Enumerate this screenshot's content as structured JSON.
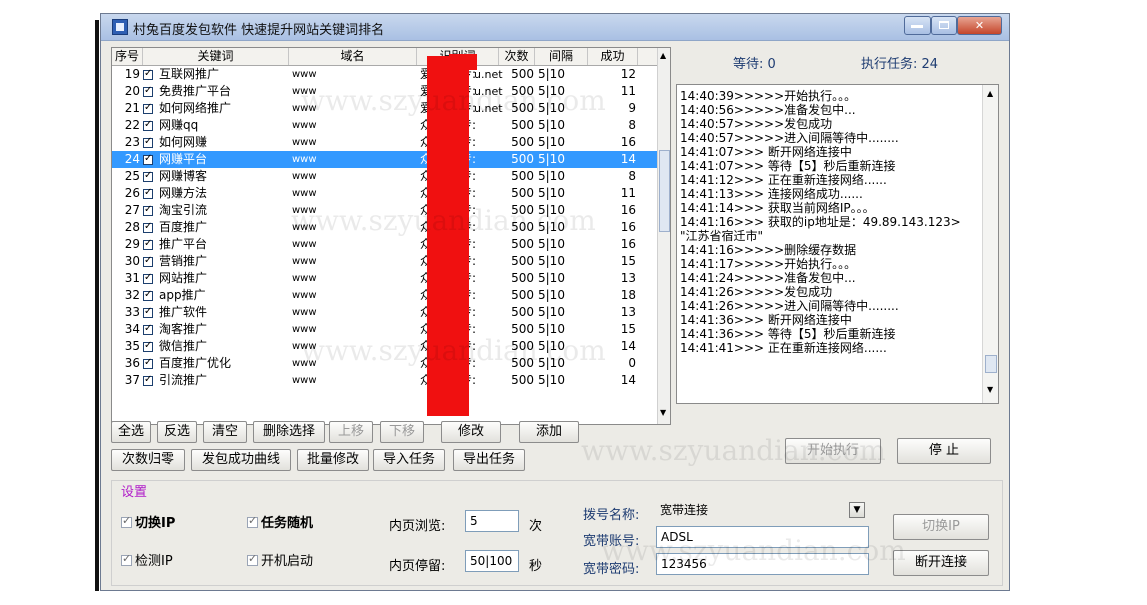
{
  "window": {
    "title": "村兔百度发包软件 快速提升网站关键词排名"
  },
  "table": {
    "headers": [
      "序号",
      "关键词",
      "域名",
      "识别词",
      "次数",
      "间隔",
      "成功"
    ],
    "rows": [
      {
        "no": "19",
        "kw": "互联网推广",
        "domain": "www",
        "domain_tail": "u.net",
        "src": "爱合购|专:",
        "count": "500",
        "interval": "5|10",
        "success": "12"
      },
      {
        "no": "20",
        "kw": "免费推广平台",
        "domain": "www",
        "domain_tail": "u.net",
        "src": "爱合购|专:",
        "count": "500",
        "interval": "5|10",
        "success": "11"
      },
      {
        "no": "21",
        "kw": "如何网络推广",
        "domain": "www",
        "domain_tail": "u.net",
        "src": "爱合购|专:",
        "count": "500",
        "interval": "5|10",
        "success": "9"
      },
      {
        "no": "22",
        "kw": "网赚qq",
        "domain": "www",
        "domain_tail": "",
        "src": "众筹网|专:",
        "count": "500",
        "interval": "5|10",
        "success": "8"
      },
      {
        "no": "23",
        "kw": "如何网赚",
        "domain": "www",
        "domain_tail": "",
        "src": "众筹网|专:",
        "count": "500",
        "interval": "5|10",
        "success": "16"
      },
      {
        "no": "24",
        "kw": "网赚平台",
        "domain": "www",
        "domain_tail": "",
        "src": "众筹网|专:",
        "count": "500",
        "interval": "5|10",
        "success": "14",
        "selected": true
      },
      {
        "no": "25",
        "kw": "网赚博客",
        "domain": "www",
        "domain_tail": "",
        "src": "众筹网|专:",
        "count": "500",
        "interval": "5|10",
        "success": "8"
      },
      {
        "no": "26",
        "kw": "网赚方法",
        "domain": "www",
        "domain_tail": "",
        "src": "众筹网|专:",
        "count": "500",
        "interval": "5|10",
        "success": "11"
      },
      {
        "no": "27",
        "kw": "淘宝引流",
        "domain": "www",
        "domain_tail": "",
        "src": "众筹网|专:",
        "count": "500",
        "interval": "5|10",
        "success": "16"
      },
      {
        "no": "28",
        "kw": "百度推广",
        "domain": "www",
        "domain_tail": "",
        "src": "众筹网|专:",
        "count": "500",
        "interval": "5|10",
        "success": "16"
      },
      {
        "no": "29",
        "kw": "推广平台",
        "domain": "www",
        "domain_tail": "",
        "src": "众筹网|专:",
        "count": "500",
        "interval": "5|10",
        "success": "16"
      },
      {
        "no": "30",
        "kw": "营销推广",
        "domain": "www",
        "domain_tail": "",
        "src": "众筹网|专:",
        "count": "500",
        "interval": "5|10",
        "success": "15"
      },
      {
        "no": "31",
        "kw": "网站推广",
        "domain": "www",
        "domain_tail": "",
        "src": "众筹网|专:",
        "count": "500",
        "interval": "5|10",
        "success": "13"
      },
      {
        "no": "32",
        "kw": "app推广",
        "domain": "www",
        "domain_tail": "",
        "src": "众筹网|专:",
        "count": "500",
        "interval": "5|10",
        "success": "18"
      },
      {
        "no": "33",
        "kw": "推广软件",
        "domain": "www",
        "domain_tail": "",
        "src": "众筹网|专:",
        "count": "500",
        "interval": "5|10",
        "success": "13"
      },
      {
        "no": "34",
        "kw": "淘客推广",
        "domain": "www",
        "domain_tail": "",
        "src": "众筹网|专:",
        "count": "500",
        "interval": "5|10",
        "success": "15"
      },
      {
        "no": "35",
        "kw": "微信推广",
        "domain": "www",
        "domain_tail": "",
        "src": "众筹网|专:",
        "count": "500",
        "interval": "5|10",
        "success": "14"
      },
      {
        "no": "36",
        "kw": "百度推广优化",
        "domain": "www",
        "domain_tail": "",
        "src": "众筹网|专:",
        "count": "500",
        "interval": "5|10",
        "success": "0"
      },
      {
        "no": "37",
        "kw": "引流推广",
        "domain": "www",
        "domain_tail": "",
        "src": "众筹网|专:",
        "count": "500",
        "interval": "5|10",
        "success": "14"
      }
    ]
  },
  "status": {
    "wait": "等待: 0",
    "tasks": "执行任务: 24"
  },
  "log": [
    "14:40:39>>>>>开始执行。。。",
    "14:40:56>>>>>准备发包中...",
    "14:40:57>>>>>发包成功",
    "14:40:57>>>>>进入间隔等待中........",
    "14:41:07>>> 断开网络连接中",
    "14:41:07>>> 等待【5】秒后重新连接",
    "14:41:12>>> 正在重新连接网络......",
    "14:41:13>>> 连接网络成功......",
    "14:41:14>>> 获取当前网络IP。。。",
    "14:41:16>>> 获取的ip地址是：49.89.143.123> \"江苏省宿迁市\"",
    "14:41:16>>>>>删除缓存数据",
    "14:41:17>>>>>开始执行。。。",
    "14:41:24>>>>>准备发包中...",
    "14:41:26>>>>>发包成功",
    "14:41:26>>>>>进入间隔等待中........",
    "14:41:36>>> 断开网络连接中",
    "14:41:36>>> 等待【5】秒后重新连接",
    "14:41:41>>> 正在重新连接网络......"
  ],
  "buttons": {
    "select_all": "全选",
    "invert": "反选",
    "clear": "清空",
    "delete_sel": "删除选择",
    "move_up": "上移",
    "move_down": "下移",
    "edit": "修改",
    "add": "添加",
    "reset_count": "次数归零",
    "curve": "发包成功曲线",
    "batch_edit": "批量修改",
    "import": "导入任务",
    "export": "导出任务",
    "start": "开始执行",
    "stop": "停 止",
    "switch_ip": "切换IP",
    "disconnect": "断开连接"
  },
  "settings": {
    "title": "设置",
    "switch_ip": "切换IP",
    "random_task": "任务随机",
    "check_ip": "检测IP",
    "autostart": "开机启动",
    "browse_label": "内页浏览:",
    "browse_value": "5",
    "browse_unit": "次",
    "stay_label": "内页停留:",
    "stay_value": "50|100",
    "stay_unit": "秒",
    "dial_label": "拨号名称:",
    "dial_value": "宽带连接",
    "account_label": "宽带账号:",
    "account_value": "ADSL",
    "password_label": "宽带密码:",
    "password_value": "123456"
  },
  "watermark": "www.szyuandian.com"
}
